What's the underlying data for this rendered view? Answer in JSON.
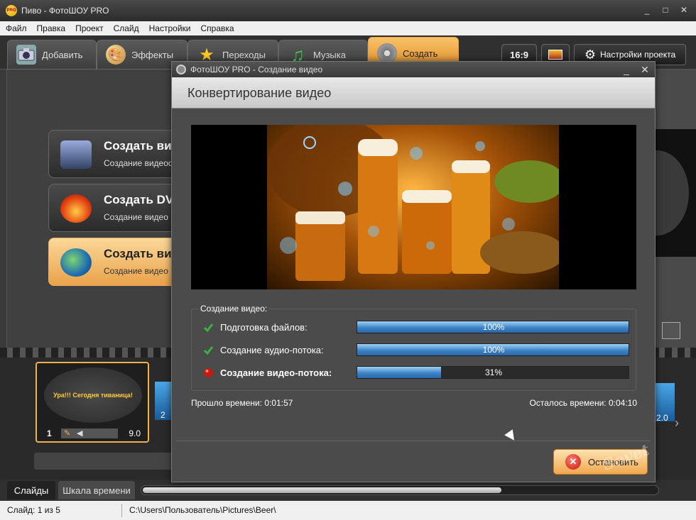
{
  "window": {
    "app_icon_glyph": "PRO",
    "title": "Пиво - ФотоШОУ PRO",
    "controls": {
      "minimize": "_",
      "maximize": "□",
      "close": "✕"
    }
  },
  "menu": [
    "Файл",
    "Правка",
    "Проект",
    "Слайд",
    "Настройки",
    "Справка"
  ],
  "tabs": [
    {
      "label": "Добавить",
      "icon": "camera-icon"
    },
    {
      "label": "Эффекты",
      "icon": "palette-icon"
    },
    {
      "label": "Переходы",
      "icon": "star-icon"
    },
    {
      "label": "Музыка",
      "icon": "music-note-icon"
    },
    {
      "label": "Создать",
      "icon": "film-reel-icon"
    }
  ],
  "toolbar_right": {
    "aspect_ratio": "16:9",
    "project_settings_label": "Настройки проекта"
  },
  "create_options": [
    {
      "title": "Создать видео",
      "subtitle": "Создание видеофайла"
    },
    {
      "title": "Создать DVD",
      "subtitle": "Создание видео"
    },
    {
      "title": "Создать вид",
      "subtitle": "Создание видео"
    }
  ],
  "slide": {
    "caption": "Ура!!! Сегодня тиваница!",
    "number": "1",
    "duration": "9.0",
    "next_duration": "2.0",
    "next_number": "2"
  },
  "bottom_tabs": [
    "Слайды",
    "Шкала времени"
  ],
  "status": {
    "slide_info": "Слайд: 1 из 5",
    "path": "C:\\Users\\Пользователь\\Pictures\\Beer\\"
  },
  "dialog": {
    "title": "ФотоШОУ PRO - Создание видео",
    "header": "Конвертирование видео",
    "group_title": "Создание видео:",
    "tasks": [
      {
        "label": "Подготовка файлов:",
        "progress": 100,
        "progress_text": "100%",
        "state": "done",
        "icon": "checkmark-icon"
      },
      {
        "label": "Создание аудио-потока:",
        "progress": 100,
        "progress_text": "100%",
        "state": "done",
        "icon": "checkmark-icon"
      },
      {
        "label": "Создание видео-потока:",
        "progress": 31,
        "progress_text": "31%",
        "state": "active",
        "icon": "red-dot-icon"
      }
    ],
    "elapsed": "Прошло времени: 0:01:57",
    "remaining": "Осталось времени: 0:04:10",
    "stop_label": "Остановить"
  },
  "watermark": "Sovet",
  "colors": {
    "accent": "#e9a24a",
    "progress_blue": "#3d84c8",
    "check_green": "#3cb043",
    "stop_red": "#c41a10"
  }
}
